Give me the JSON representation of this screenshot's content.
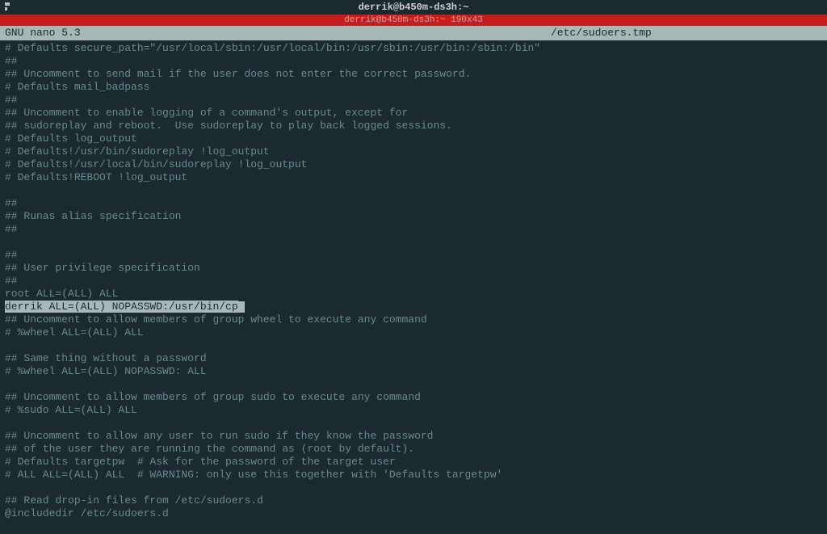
{
  "titlebar": {
    "title": "derrik@b450m-ds3h:~"
  },
  "redbar": {
    "text": "derrik@b450m-ds3h:~ 190x43"
  },
  "header": {
    "app": "  GNU nano 5.3",
    "filename": "/etc/sudoers.tmp"
  },
  "lines": [
    "# Defaults secure_path=\"/usr/local/sbin:/usr/local/bin:/usr/sbin:/usr/bin:/sbin:/bin\"",
    "##",
    "## Uncomment to send mail if the user does not enter the correct password.",
    "# Defaults mail_badpass",
    "##",
    "## Uncomment to enable logging of a command's output, except for",
    "## sudoreplay and reboot.  Use sudoreplay to play back logged sessions.",
    "# Defaults log_output",
    "# Defaults!/usr/bin/sudoreplay !log_output",
    "# Defaults!/usr/local/bin/sudoreplay !log_output",
    "# Defaults!REBOOT !log_output",
    "",
    "##",
    "## Runas alias specification",
    "##",
    "",
    "##",
    "## User privilege specification",
    "##",
    "root ALL=(ALL) ALL",
    "",
    "## Uncomment to allow members of group wheel to execute any command",
    "# %wheel ALL=(ALL) ALL",
    "",
    "## Same thing without a password",
    "# %wheel ALL=(ALL) NOPASSWD: ALL",
    "",
    "## Uncomment to allow members of group sudo to execute any command",
    "# %sudo ALL=(ALL) ALL",
    "",
    "## Uncomment to allow any user to run sudo if they know the password",
    "## of the user they are running the command as (root by default).",
    "# Defaults targetpw  # Ask for the password of the target user",
    "# ALL ALL=(ALL) ALL  # WARNING: only use this together with 'Defaults targetpw'",
    "",
    "## Read drop-in files from /etc/sudoers.d",
    "@includedir /etc/sudoers.d"
  ],
  "highlighted_line": "derrik ALL=(ALL) NOPASSWD:/usr/bin/cp",
  "highlighted_index": 20
}
